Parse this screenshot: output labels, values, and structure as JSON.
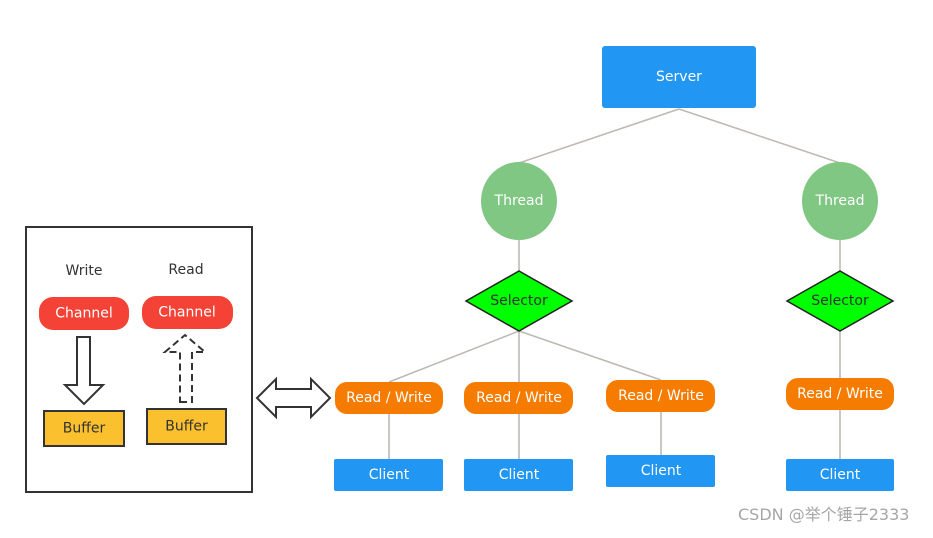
{
  "colors": {
    "server": "#2196f3",
    "thread": "#81c784",
    "selector": "#00ff00",
    "read_write": "#f57c00",
    "client": "#2196f3",
    "channel": "#f44336",
    "buffer": "#fbc02d"
  },
  "server": "Server",
  "threads": [
    "Thread",
    "Thread"
  ],
  "selectors": [
    "Selector",
    "Selector"
  ],
  "read_write": [
    "Read / Write",
    "Read / Write",
    "Read / Write",
    "Read / Write"
  ],
  "clients": [
    "Client",
    "Client",
    "Client",
    "Client"
  ],
  "panel": {
    "write_label": "Write",
    "read_label": "Read",
    "write_channel": "Channel",
    "read_channel": "Channel",
    "write_buffer": "Buffer",
    "read_buffer": "Buffer"
  },
  "watermark": "CSDN @举个锤子2333"
}
